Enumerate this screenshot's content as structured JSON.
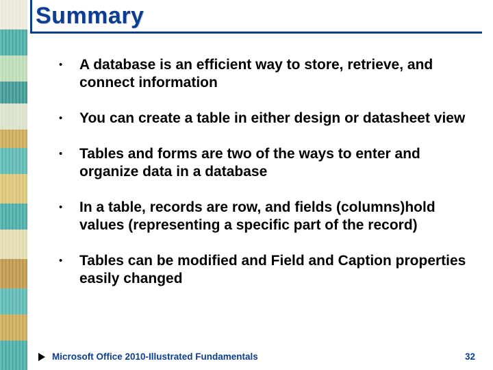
{
  "title": "Summary",
  "bullets": [
    "A database is an efficient way to store, retrieve, and connect information",
    "You can create a table in either design or datasheet view",
    "Tables and forms are two of the ways to enter and organize data in a database",
    "In a table, records are row, and fields (columns)hold values (representing a specific part of the record)",
    "Tables can be modified and Field and Caption properties easily changed"
  ],
  "footer": {
    "text": "Microsoft Office 2010-Illustrated Fundamentals",
    "page": "32"
  },
  "colors": {
    "accent": "#0b3d91"
  }
}
